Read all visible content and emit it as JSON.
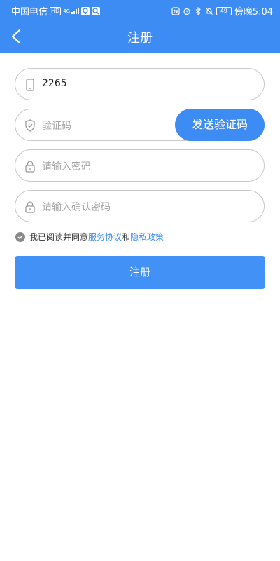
{
  "status_bar": {
    "carrier": "中国电信",
    "hd_badge": "HD",
    "network": "4G",
    "battery_level": "49",
    "time": "傍晚5:04",
    "left_icons": [
      "hd-icon",
      "signal-icon",
      "bulb-app-icon",
      "search-app-icon"
    ],
    "right_icons": [
      "nfc-icon",
      "alarm-icon",
      "bluetooth-icon",
      "mute-icon",
      "battery-icon"
    ]
  },
  "header": {
    "title": "注册",
    "back_icon": "chevron-left-icon"
  },
  "form": {
    "phone": {
      "value": "2265",
      "icon": "phone-icon"
    },
    "code": {
      "placeholder": "验证码",
      "icon": "shield-icon",
      "send_button_label": "发送验证码"
    },
    "password": {
      "placeholder": "请输入密码",
      "icon": "lock-icon"
    },
    "confirm_password": {
      "placeholder": "请输入确认密码",
      "icon": "lock-icon"
    }
  },
  "agreement": {
    "checked": true,
    "prefix": "我已阅读并同意",
    "service_link": "服务协议",
    "and_text": "和",
    "privacy_link": "隐私政策"
  },
  "submit_button": {
    "label": "注册"
  },
  "colors": {
    "primary": "#3d8cf4",
    "border": "#c9c9c9",
    "placeholder": "#a5a5a5"
  }
}
